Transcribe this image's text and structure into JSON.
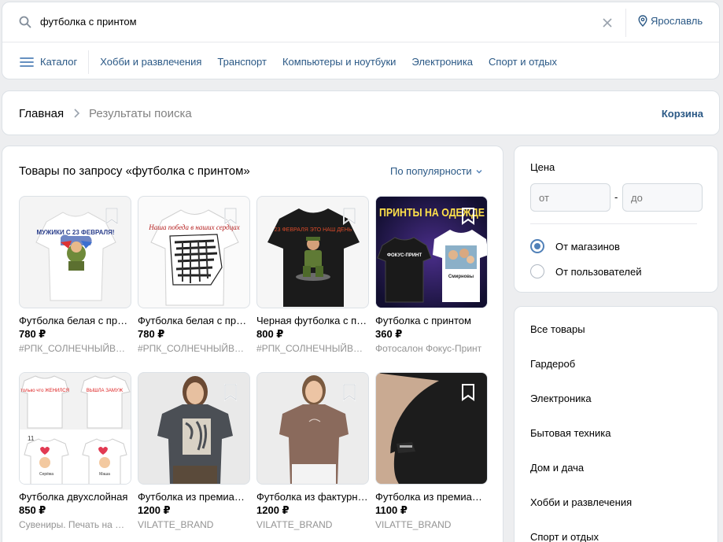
{
  "search": {
    "value": "футболка с принтом"
  },
  "location": {
    "city": "Ярославль"
  },
  "catalog_nav": {
    "catalog_label": "Каталог",
    "links": [
      "Хобби и развлечения",
      "Транспорт",
      "Компьютеры и ноутбуки",
      "Электроника",
      "Спорт и отдых"
    ]
  },
  "breadcrumb": {
    "home": "Главная",
    "current": "Результаты поиска",
    "cart": "Корзина"
  },
  "results": {
    "title": "Товары по запросу «футболка с принтом»",
    "sort_label": "По популярности",
    "items": [
      {
        "name": "Футболка белая с принтом",
        "price": "780 ₽",
        "seller": "#РПК_СОЛНЕЧНЫЙВЕТЕР"
      },
      {
        "name": "Футболка белая с принтом",
        "price": "780 ₽",
        "seller": "#РПК_СОЛНЕЧНЫЙВЕТЕР"
      },
      {
        "name": "Черная футболка с принтом",
        "price": "800 ₽",
        "seller": "#РПК_СОЛНЕЧНЫЙВЕТЕР"
      },
      {
        "name": "Футболка с принтом",
        "price": "360 ₽",
        "seller": "Фотосалон Фокус-Принт"
      },
      {
        "name": "Футболка двухслойная",
        "price": "850 ₽",
        "seller": "Сувениры. Печать на футболках"
      },
      {
        "name": "Футболка из премиального хлопка",
        "price": "1200 ₽",
        "seller": "VILATTE_BRAND"
      },
      {
        "name": "Футболка из фактурного хлопка",
        "price": "1200 ₽",
        "seller": "VILATTE_BRAND"
      },
      {
        "name": "Футболка из премиального хлопка",
        "price": "1100 ₽",
        "seller": "VILATTE_BRAND"
      }
    ],
    "image_texts": {
      "shirt1": "МУЖИКИ С 23 ФЕВРАЛЯ!",
      "shirt2": "Наша победа в наших сердцах",
      "shirt3": "23 ФЕВРАЛЯ ЭТО НАШ ДЕНЬ",
      "banner_top": "ПРИНТЫ НА ОДЕЖДЕ",
      "banner_black_shirt": "ФОКУС-ПРИНТ",
      "banner_white_shirt": "Смирновы",
      "couple_left": "только что ЖЕНИЛСЯ",
      "couple_right": "ВЫШЛА ЗАМУЖ",
      "couple_number": "11",
      "couple_name_left": "Серёжа",
      "couple_name_right": "Маша"
    }
  },
  "filters": {
    "price_label": "Цена",
    "from_placeholder": "от",
    "to_placeholder": "до",
    "dash": "-",
    "options": [
      "От магазинов",
      "От пользователей"
    ],
    "selected_option": "От магазинов"
  },
  "categories": [
    "Все товары",
    "Гардероб",
    "Электроника",
    "Бытовая техника",
    "Дом и дача",
    "Хобби и развлечения",
    "Спорт и отдых"
  ],
  "colors": {
    "accent": "#2a5885",
    "radio": "#5181b8",
    "muted": "#939393",
    "bg": "#edeef0"
  }
}
